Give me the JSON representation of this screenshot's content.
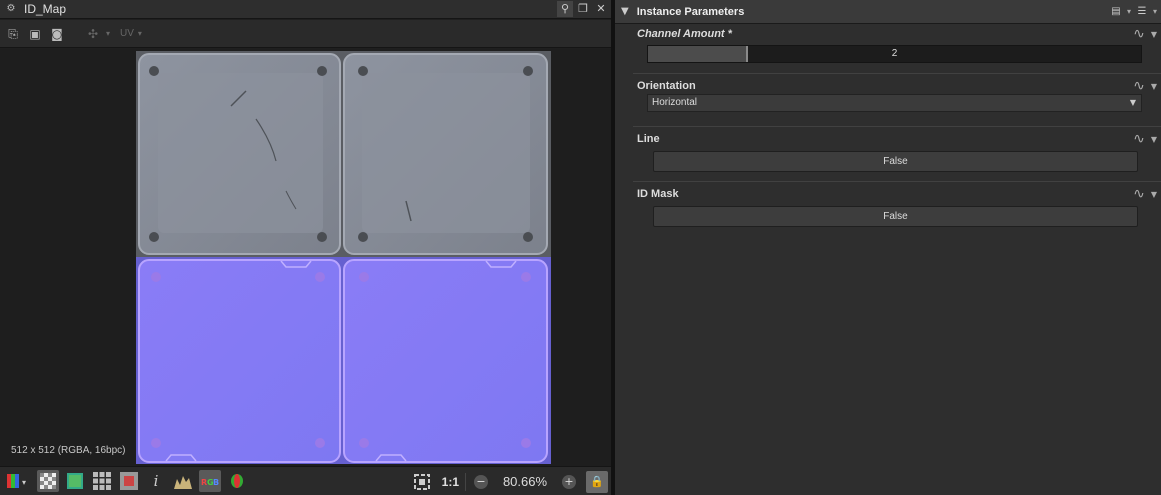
{
  "view": {
    "title": "ID_Map",
    "toolbar": {
      "uv_label": "UV"
    },
    "resolution_info": "512 x 512 (RGBA, 16bpc)",
    "bottom": {
      "ratio_label": "1:1",
      "zoom": "80.66%"
    }
  },
  "params": {
    "title": "Instance Parameters",
    "channel_amount": {
      "label": "Channel Amount *",
      "value": "2",
      "fill_fraction": 0.2
    },
    "orientation": {
      "label": "Orientation",
      "value": "Horizontal"
    },
    "line": {
      "label": "Line",
      "value": "False"
    },
    "id_mask": {
      "label": "ID Mask",
      "value": "False"
    }
  }
}
